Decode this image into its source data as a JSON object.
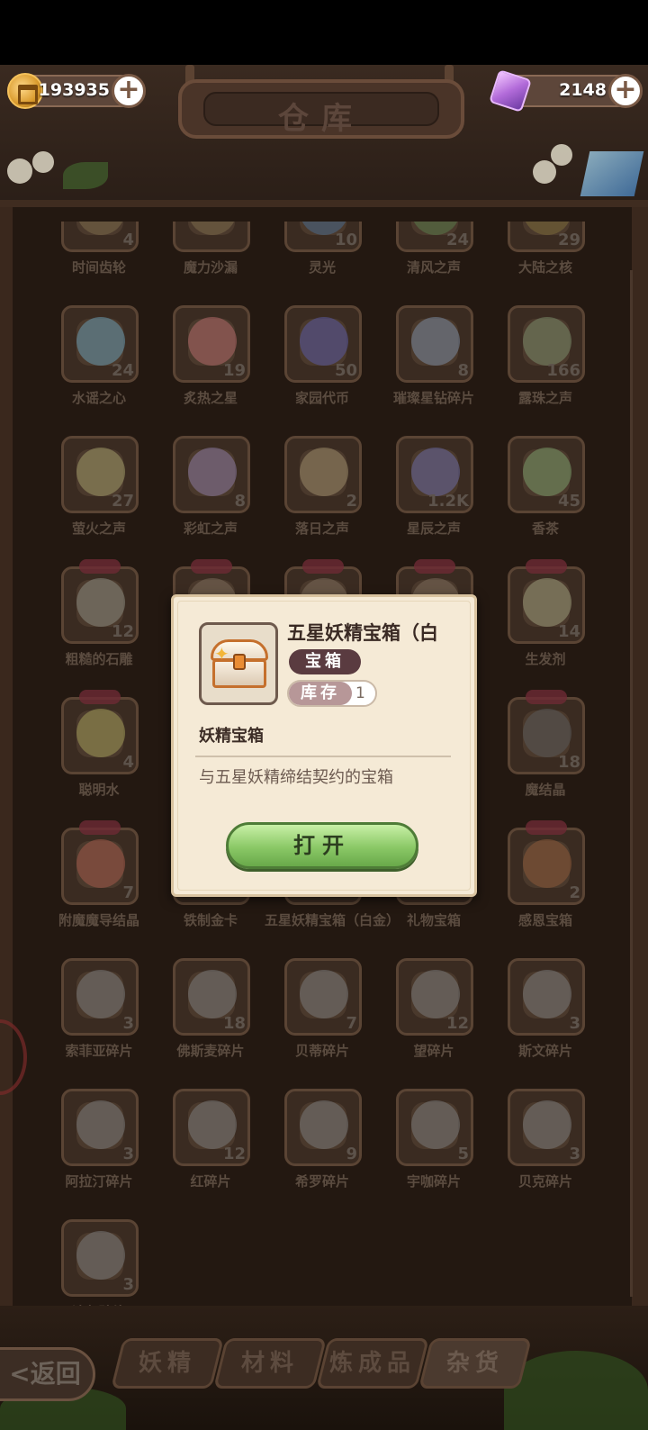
{
  "header": {
    "title": "仓库",
    "coins": "193935",
    "gems": "2148"
  },
  "items": [
    {
      "name": "时间齿轮",
      "count": "4",
      "color": "#7a6a4a"
    },
    {
      "name": "魔力沙漏",
      "count": "",
      "color": "#7a6a4a"
    },
    {
      "name": "灵光",
      "count": "10",
      "color": "#4a6a8a"
    },
    {
      "name": "清风之声",
      "count": "24",
      "color": "#5a7a4a"
    },
    {
      "name": "大陆之核",
      "count": "29",
      "color": "#7a6a3a"
    },
    {
      "name": "水谣之心",
      "count": "24",
      "color": "#6a9ab0"
    },
    {
      "name": "炙热之星",
      "count": "19",
      "color": "#b06a6a"
    },
    {
      "name": "家园代币",
      "count": "50",
      "color": "#5a5aa0"
    },
    {
      "name": "璀璨星钻碎片",
      "count": "8",
      "color": "#7a8aa0"
    },
    {
      "name": "露珠之声",
      "count": "166",
      "color": "#7a8a6a"
    },
    {
      "name": "萤火之声",
      "count": "27",
      "color": "#a09a6a"
    },
    {
      "name": "彩虹之声",
      "count": "8",
      "color": "#8a7aa0"
    },
    {
      "name": "落日之声",
      "count": "2",
      "color": "#9a8a6a"
    },
    {
      "name": "星辰之声",
      "count": "1.2K",
      "color": "#6a6aa0"
    },
    {
      "name": "香茶",
      "count": "45",
      "color": "#7a9a6a"
    },
    {
      "name": "粗糙的石雕",
      "count": "12",
      "color": "#8a8a80"
    },
    {
      "name": "",
      "count": "",
      "color": "#7a6a5a"
    },
    {
      "name": "",
      "count": "",
      "color": "#7a6a5a"
    },
    {
      "name": "",
      "count": "",
      "color": "#7a6a5a"
    },
    {
      "name": "生发剂",
      "count": "14",
      "color": "#9a9a7a"
    },
    {
      "name": "聪明水",
      "count": "4",
      "color": "#a09a5a"
    },
    {
      "name": "",
      "count": "",
      "color": "#7a6a5a"
    },
    {
      "name": "",
      "count": "",
      "color": "#7a6a5a"
    },
    {
      "name": "",
      "count": "",
      "color": "#7a6a5a"
    },
    {
      "name": "魔结晶",
      "count": "18",
      "color": "#5a5a5a"
    },
    {
      "name": "附魔魔导结晶",
      "count": "7",
      "color": "#a05a4a"
    },
    {
      "name": "铁制金卡",
      "count": "",
      "color": "#8a7a5a"
    },
    {
      "name": "五星妖精宝箱（白金）",
      "count": "",
      "color": "#8a7a6a"
    },
    {
      "name": "礼物宝箱",
      "count": "",
      "color": "#8a6a5a"
    },
    {
      "name": "感恩宝箱",
      "count": "2",
      "color": "#8a5a3a"
    },
    {
      "name": "索菲亚碎片",
      "count": "3",
      "color": "#7a7a7a"
    },
    {
      "name": "佛斯麦碎片",
      "count": "18",
      "color": "#7a7a7a"
    },
    {
      "name": "贝蒂碎片",
      "count": "7",
      "color": "#7a7a7a"
    },
    {
      "name": "望碎片",
      "count": "12",
      "color": "#7a7a7a"
    },
    {
      "name": "斯文碎片",
      "count": "3",
      "color": "#7a7a7a"
    },
    {
      "name": "阿拉汀碎片",
      "count": "3",
      "color": "#7a7a7a"
    },
    {
      "name": "红碎片",
      "count": "12",
      "color": "#7a7a7a"
    },
    {
      "name": "希罗碎片",
      "count": "9",
      "color": "#7a7a7a"
    },
    {
      "name": "宇咖碎片",
      "count": "5",
      "color": "#7a7a7a"
    },
    {
      "name": "贝克碎片",
      "count": "3",
      "color": "#7a7a7a"
    },
    {
      "name": "达尔碎片",
      "count": "3",
      "color": "#7a7a7a"
    }
  ],
  "popup": {
    "title": "五星妖精宝箱（白",
    "type_badge": "宝箱",
    "stock_label": "库存",
    "stock_value": "1",
    "subtitle": "妖精宝箱",
    "description": "与五星妖精缔结契约的宝箱",
    "open_button": "打开"
  },
  "tabs": [
    {
      "label": "妖精",
      "active": false
    },
    {
      "label": "材料",
      "active": false
    },
    {
      "label": "炼成品",
      "active": false
    },
    {
      "label": "杂货",
      "active": true
    }
  ],
  "back_button": "<返回"
}
